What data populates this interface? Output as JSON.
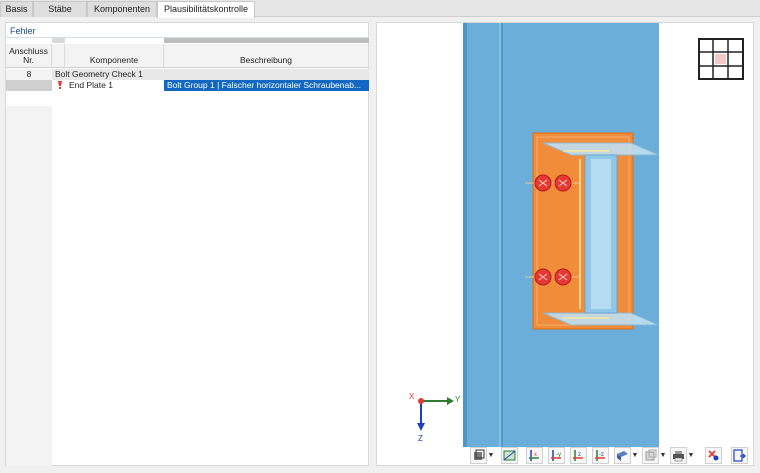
{
  "tabs": [
    {
      "label": "Basis"
    },
    {
      "label": "Stäbe"
    },
    {
      "label": "Komponenten"
    },
    {
      "label": "Plausibilitätskontrolle",
      "active": true
    }
  ],
  "errors_panel": {
    "title": "Fehler",
    "columns": {
      "nr_line1": "Anschluss",
      "nr_line2": "Nr.",
      "component": "Komponente",
      "description": "Beschreibung"
    },
    "rows": [
      {
        "nr": "8",
        "component": "Bolt Geometry Check 1",
        "description": ""
      },
      {
        "nr": "",
        "component": "End Plate 1",
        "description": "Bolt Group 1 | Falscher horizontaler Schraubenab...",
        "selected": true
      }
    ]
  },
  "viewport": {
    "axis_labels": {
      "x": "X",
      "y": "Y",
      "z": "Z"
    },
    "colors": {
      "column": "#6aaed9",
      "plate": "#f08c3a",
      "bolt": "#e53935",
      "axis_x": "#e53935",
      "axis_y": "#2e7d32",
      "axis_z": "#1e3fbf"
    }
  },
  "toolbar": {
    "icons": [
      "display-options-icon",
      "model-view-icon",
      "view-x-icon",
      "view-minus-y-icon",
      "view-z-icon",
      "view-minus-z-icon",
      "render-mode-icon",
      "transparency-icon",
      "print-icon",
      "clear-selection-icon",
      "exit-view-icon"
    ]
  }
}
